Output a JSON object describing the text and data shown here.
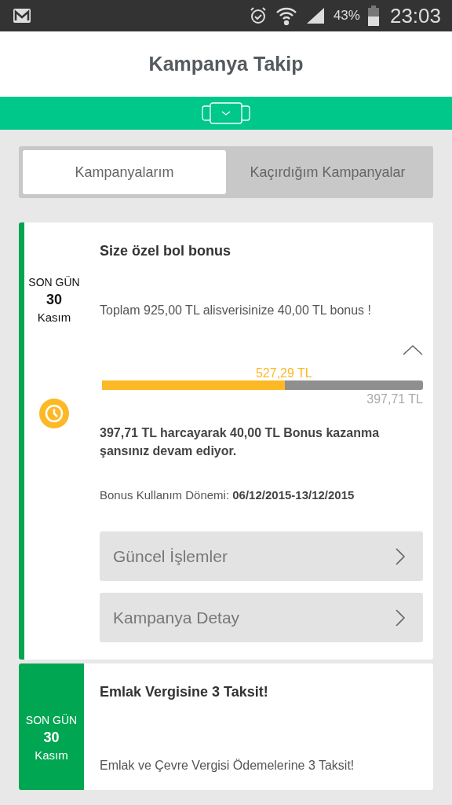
{
  "status_bar": {
    "battery": "43%",
    "time": "23:03"
  },
  "header": {
    "title": "Kampanya Takip"
  },
  "tabs": [
    {
      "label": "Kampanyalarım",
      "selected": true
    },
    {
      "label": "Kaçırdığım Kampanyalar",
      "selected": false
    }
  ],
  "campaigns": [
    {
      "expanded": true,
      "deadline": {
        "label": "SON GÜN",
        "day": "30",
        "month": "Kasım"
      },
      "title": "Size özel bol bonus",
      "description": "Toplam 925,00 TL alisverisinize 40,00 TL bonus !",
      "progress": {
        "spent": "527,29 TL",
        "level": 0.57,
        "remaining": "397,71 TL"
      },
      "message": "397,71 TL harcayarak 40,00 TL Bonus kazanma şansınız devam ediyor.",
      "period": "Bonus Kullanım Dönemi: **06/12/2015-13/12/2015**",
      "buttons": [
        "Güncel İşlemler",
        "Kampanya Detay"
      ]
    },
    {
      "expanded": false,
      "deadline": {
        "label": "SON GÜN",
        "day": "30",
        "month": "Kasım"
      },
      "title": "Emlak Vergisine 3 Taksit!",
      "description": "Emlak ve Çevre Vergisi Ödemelerine 3 Taksit!"
    }
  ]
}
